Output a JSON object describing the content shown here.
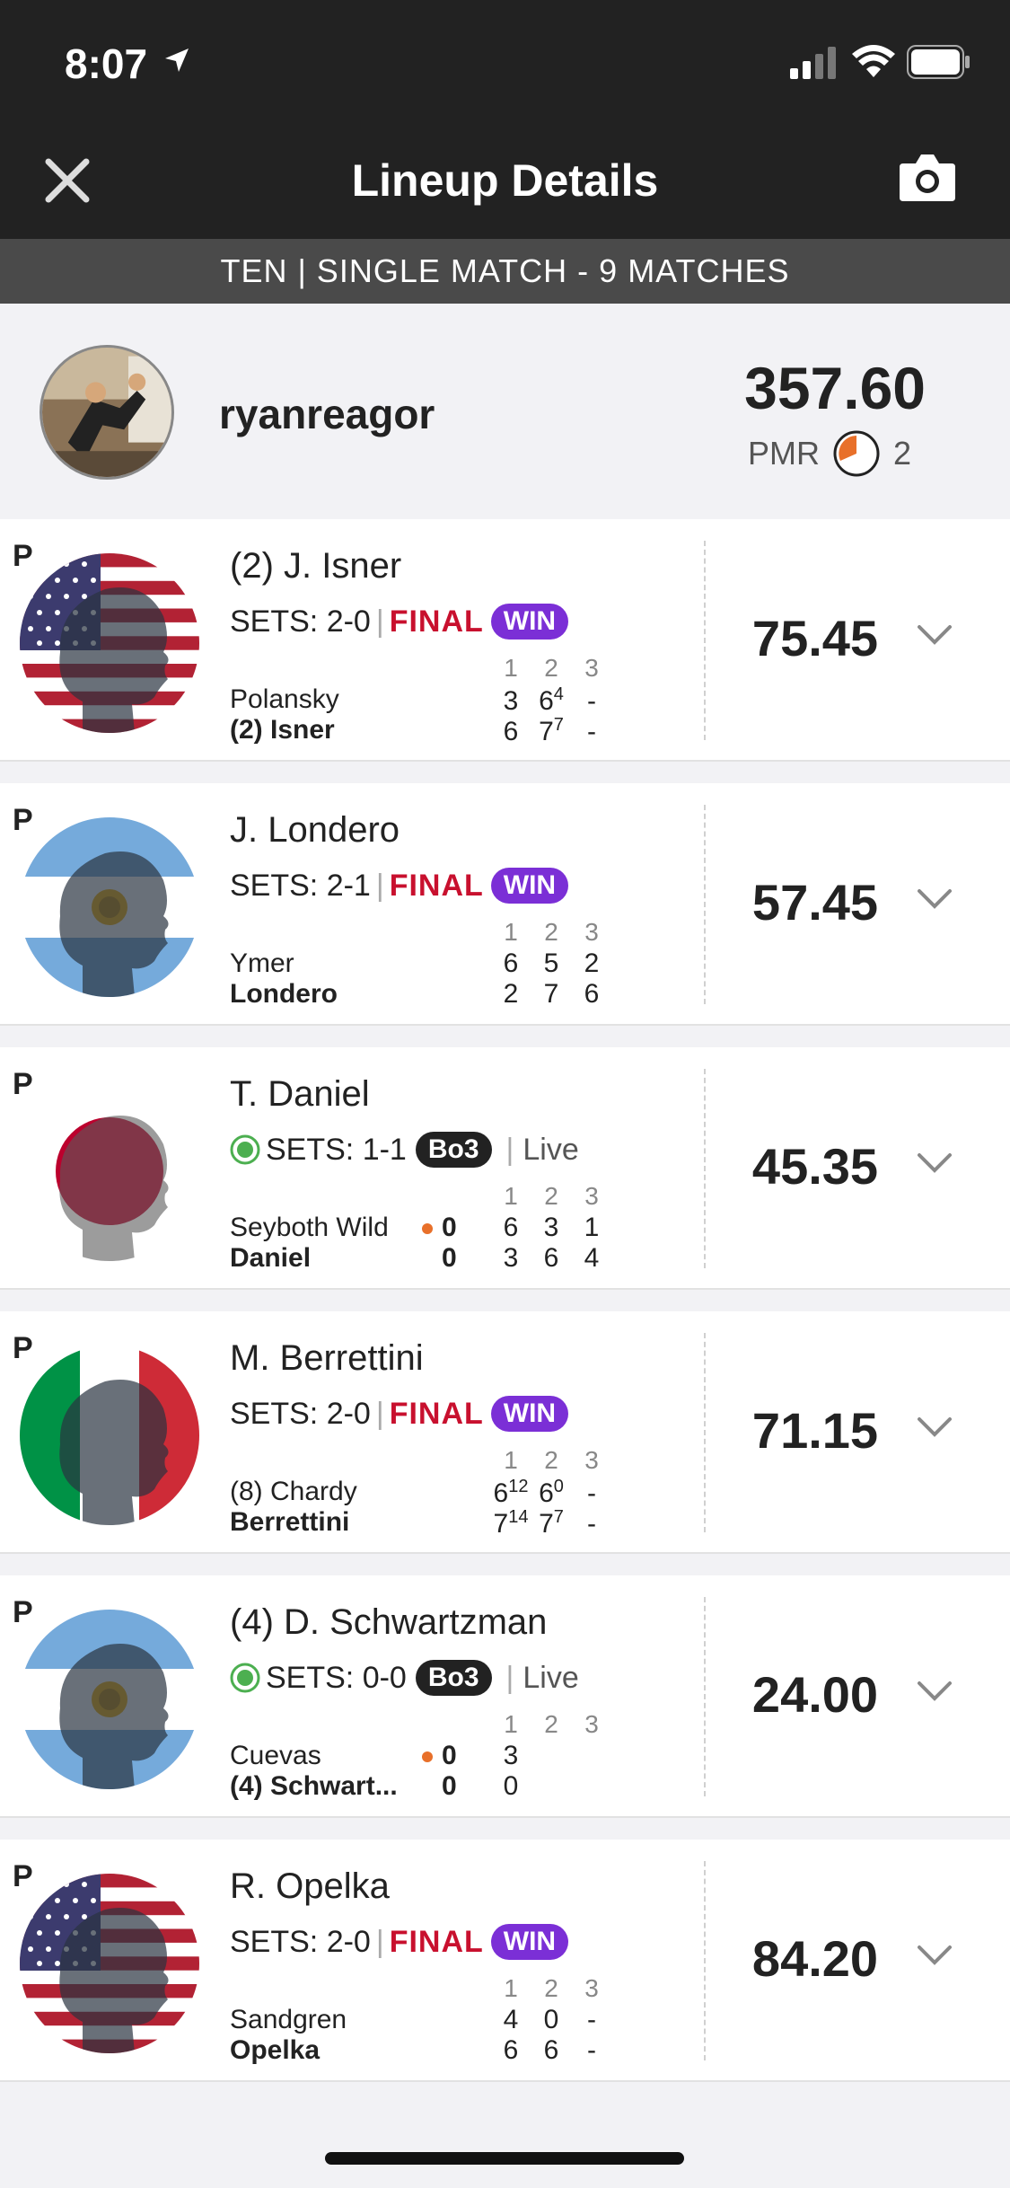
{
  "status_bar": {
    "time": "8:07"
  },
  "nav": {
    "title": "Lineup Details"
  },
  "subheader": "TEN | SINGLE MATCH - 9 MATCHES",
  "user": {
    "username": "ryanreagor",
    "score": "357.60",
    "pmr_label": "PMR",
    "pmr_value": "2"
  },
  "set_headers": [
    "1",
    "2",
    "3"
  ],
  "colors": {
    "final": "#c8102e",
    "win": "#7b2fd6",
    "live": "#4caf50",
    "serve_dot": "#e8702a"
  },
  "players": [
    {
      "pos": "P",
      "name": "(2) J. Isner",
      "flag": "usa-flag",
      "sets": "SETS: 2-0",
      "status": "FINAL",
      "result": "WIN",
      "opponent": "Polansky",
      "me": "(2) Isner",
      "opp_scores": [
        "3",
        "6",
        "-"
      ],
      "opp_tb": [
        "",
        "4",
        ""
      ],
      "me_scores": [
        "6",
        "7",
        "-"
      ],
      "me_tb": [
        "",
        "7",
        ""
      ],
      "points": "75.45"
    },
    {
      "pos": "P",
      "name": "J. Londero",
      "flag": "argentina-flag",
      "sets": "SETS: 2-1",
      "status": "FINAL",
      "result": "WIN",
      "opponent": "Ymer",
      "me": "Londero",
      "opp_scores": [
        "6",
        "5",
        "2"
      ],
      "opp_tb": [
        "",
        "",
        ""
      ],
      "me_scores": [
        "2",
        "7",
        "6"
      ],
      "me_tb": [
        "",
        "",
        ""
      ],
      "points": "57.45"
    },
    {
      "pos": "P",
      "name": "T. Daniel",
      "flag": "japan-flag",
      "sets": "SETS: 1-1",
      "format": "Bo3",
      "live": "Live",
      "opponent": "Seyboth Wild",
      "me": "Daniel",
      "opp_game": "0",
      "me_game": "0",
      "opp_scores": [
        "6",
        "3",
        "1"
      ],
      "me_scores": [
        "3",
        "6",
        "4"
      ],
      "points": "45.35"
    },
    {
      "pos": "P",
      "name": "M. Berrettini",
      "flag": "italy-flag",
      "sets": "SETS: 2-0",
      "status": "FINAL",
      "result": "WIN",
      "opponent": "(8) Chardy",
      "me": "Berrettini",
      "opp_scores": [
        "6",
        "6",
        "-"
      ],
      "opp_tb": [
        "12",
        "0",
        ""
      ],
      "me_scores": [
        "7",
        "7",
        "-"
      ],
      "me_tb": [
        "14",
        "7",
        ""
      ],
      "points": "71.15"
    },
    {
      "pos": "P",
      "name": "(4) D. Schwartzman",
      "flag": "argentina-flag",
      "sets": "SETS: 0-0",
      "format": "Bo3",
      "live": "Live",
      "opponent": "Cuevas",
      "me": "(4) Schwart...",
      "opp_game": "0",
      "me_game": "0",
      "opp_scores": [
        "3",
        "",
        ""
      ],
      "me_scores": [
        "0",
        "",
        ""
      ],
      "points": "24.00"
    },
    {
      "pos": "P",
      "name": "R. Opelka",
      "flag": "usa-flag",
      "sets": "SETS: 2-0",
      "status": "FINAL",
      "result": "WIN",
      "opponent": "Sandgren",
      "me": "Opelka",
      "opp_scores": [
        "4",
        "0",
        "-"
      ],
      "opp_tb": [
        "",
        "",
        ""
      ],
      "me_scores": [
        "6",
        "6",
        "-"
      ],
      "me_tb": [
        "",
        "",
        ""
      ],
      "points": "84.20"
    }
  ]
}
